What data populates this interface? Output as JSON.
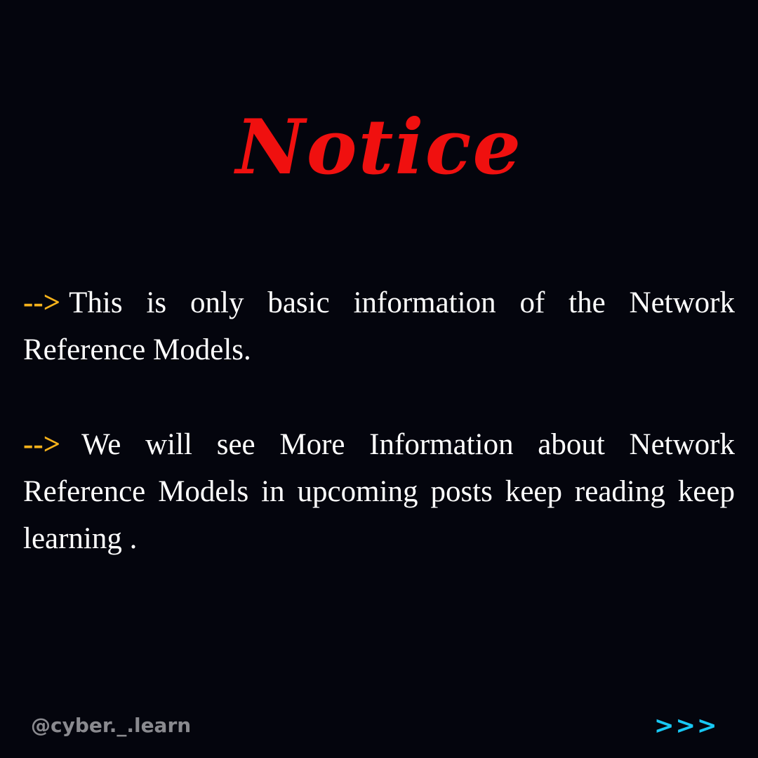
{
  "title": "Notice",
  "paragraphs": [
    {
      "arrow": "-->",
      "text": "This is only basic information of the Network Reference Models."
    },
    {
      "arrow": "-->",
      "text": "We will see More Information about Network Reference Models in upcoming posts keep reading keep learning ."
    }
  ],
  "footer": {
    "handle": "@cyber._.learn",
    "next": ">>>"
  },
  "colors": {
    "background": "#04050d",
    "title": "#f0100f",
    "arrow": "#f6b21b",
    "text": "#ffffff",
    "handle": "#8a8a8f",
    "next": "#18c8f4"
  }
}
